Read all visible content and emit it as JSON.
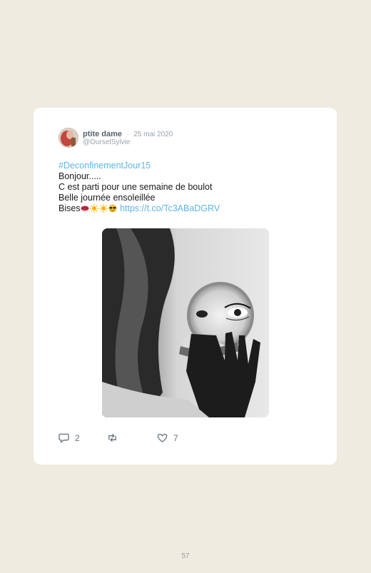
{
  "tweet": {
    "author_name": "ptite dame",
    "separator": "·",
    "date": "25 mai 2020",
    "handle": "@OurselSylvie",
    "hashtag": "#DeconfinementJour15",
    "line1": "Bonjour.....",
    "line2": "C est parti pour une semaine de boulot",
    "line3": "Belle journée ensoleillée",
    "line4_text": "Bises",
    "emojis": [
      "kiss-lips-icon",
      "sun-icon",
      "sun-icon",
      "sunglasses-face-icon"
    ],
    "link": "https://t.co/Tc3ABaDGRV",
    "image_icon": "woman-with-mirror-photo"
  },
  "actions": {
    "reply_count": "2",
    "retweet_count": "",
    "like_count": "7"
  },
  "page_number": "57",
  "colors": {
    "background": "#efebe1",
    "card": "#ffffff",
    "link": "#5fb5e6",
    "muted": "#9aa3ab"
  }
}
